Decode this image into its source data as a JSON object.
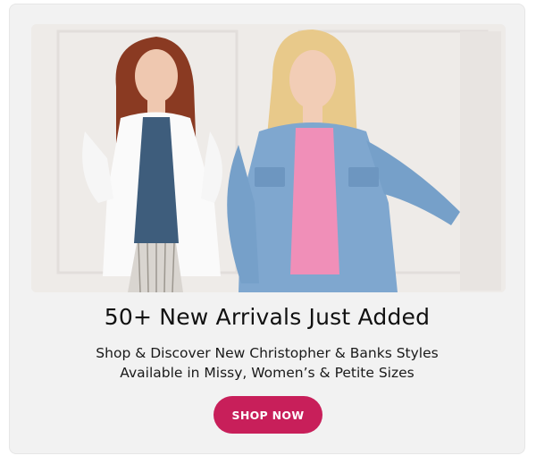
{
  "promo": {
    "headline": "50+ New Arrivals Just Added",
    "subline_1": "Shop & Discover New Christopher & Banks Styles",
    "subline_2": "Available in Missy, Women’s & Petite Sizes",
    "cta_label": "SHOP NOW",
    "cta_color": "#c81f5a"
  }
}
